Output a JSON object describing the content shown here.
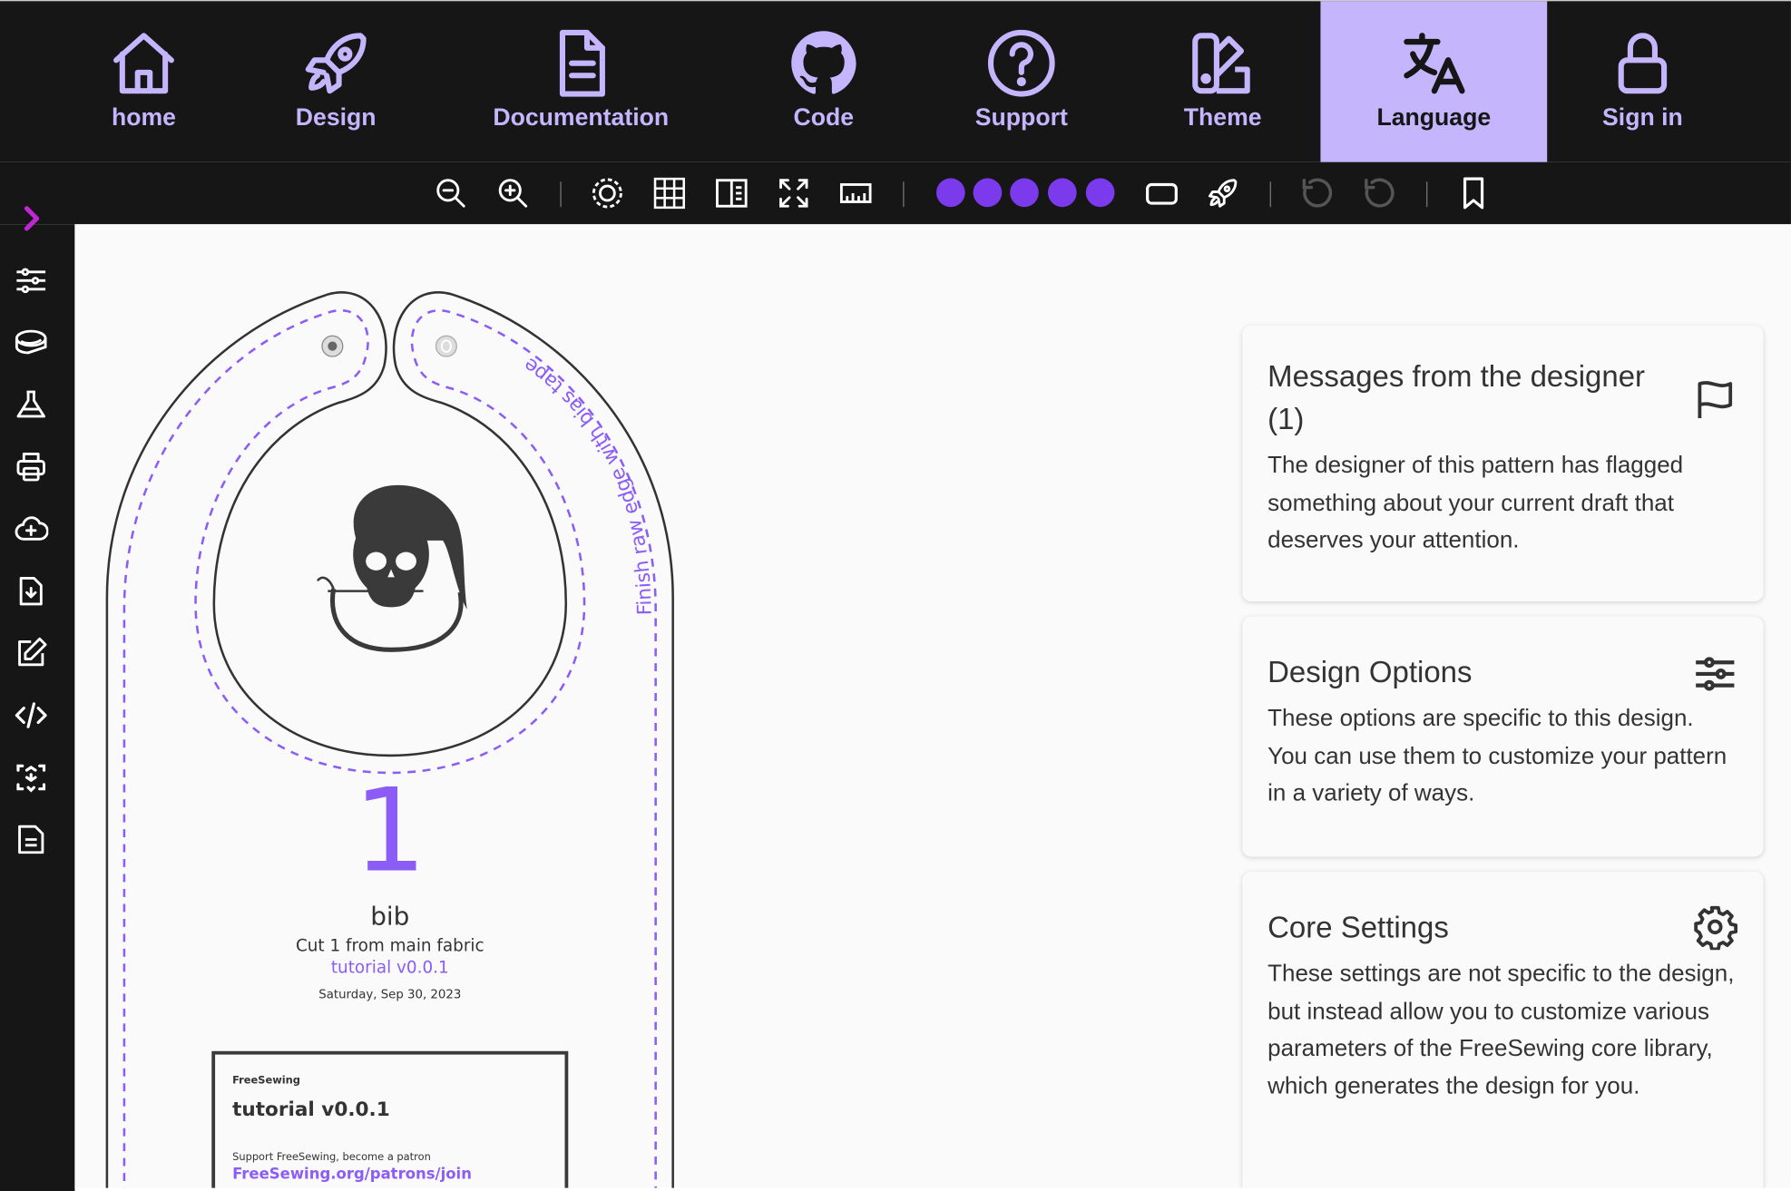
{
  "colors": {
    "nav_bg": "#161616",
    "nav_fg": "#c4b5fd",
    "accent": "#7c3aed",
    "chevron": "#c026d3",
    "canvas_bg": "#fafafa",
    "ink": "#333333",
    "pattern_purple": "#8b5cf6"
  },
  "nav": {
    "items": [
      {
        "label": "home",
        "icon": "home-icon"
      },
      {
        "label": "Design",
        "icon": "rocket-icon"
      },
      {
        "label": "Documentation",
        "icon": "document-icon"
      },
      {
        "label": "Code",
        "icon": "github-icon"
      },
      {
        "label": "Support",
        "icon": "question-icon"
      },
      {
        "label": "Theme",
        "icon": "swatch-icon"
      },
      {
        "label": "Language",
        "icon": "translate-icon",
        "active": true
      },
      {
        "label": "Sign in",
        "icon": "lock-icon"
      }
    ]
  },
  "toolbar": {
    "icons": [
      "zoom-out-icon",
      "zoom-in-icon",
      "sa-icon",
      "grid-icon",
      "paper-icon",
      "fullscreen-icon",
      "ruler-icon",
      "detail-level-dots",
      "frame-icon",
      "rocket-icon",
      "undo-icon",
      "redo-icon",
      "bookmark-icon"
    ],
    "detail_level_dots": 5
  },
  "sidebar": {
    "icons": [
      "chevron-right-icon",
      "sliders-icon",
      "tape-icon",
      "flask-icon",
      "printer-icon",
      "cloud-upload-icon",
      "download-icon",
      "edit-icon",
      "code-icon",
      "inspect-icon",
      "document-icon"
    ]
  },
  "pattern": {
    "part_number": "1",
    "part_name": "bib",
    "cut": "Cut 1 from main fabric",
    "design": "tutorial v0.0.1",
    "date": "Saturday, Sep 30, 2023",
    "edge_note": "Finish raw edge with bias tape",
    "title_block": {
      "brand": "FreeSewing",
      "title": "tutorial v0.0.1",
      "support": "Support FreeSewing, become a patron",
      "link": "FreeSewing.org/patrons/join"
    }
  },
  "cards": [
    {
      "title": "Messages from the designer (1)",
      "body": "The designer of this pattern has flagged something about your current draft that deserves your attention.",
      "icon": "flag-icon"
    },
    {
      "title": "Design Options",
      "body": "These options are specific to this design. You can use them to customize your pattern in a variety of ways.",
      "icon": "sliders-icon"
    },
    {
      "title": "Core Settings",
      "body": "These settings are not specific to the design, but instead allow you to customize various parameters of the FreeSewing core library, which generates the design for you.",
      "icon": "gear-icon"
    }
  ]
}
